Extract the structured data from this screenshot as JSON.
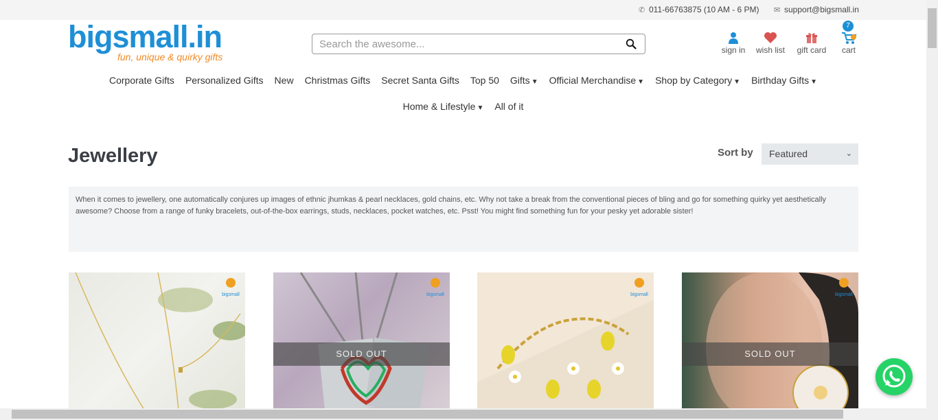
{
  "topbar": {
    "phone": "011-66763875 (10 AM - 6 PM)",
    "email": "support@bigsmall.in"
  },
  "logo": {
    "brand": "bigsmall.in",
    "tagline": "fun, unique & quirky gifts"
  },
  "search": {
    "placeholder": "Search the awesome..."
  },
  "account": {
    "signin": "sign in",
    "wishlist": "wish list",
    "giftcard": "gift card",
    "cart": "cart",
    "cart_count": "7"
  },
  "nav": {
    "row1": [
      "Corporate Gifts",
      "Personalized Gifts",
      "New",
      "Christmas Gifts",
      "Secret Santa Gifts",
      "Top 50",
      "Gifts",
      "Official Merchandise",
      "Shop by Category",
      "Birthday Gifts"
    ],
    "row2": [
      "Home & Lifestyle",
      "All of it"
    ]
  },
  "page": {
    "title": "Jewellery",
    "sort_label": "Sort by",
    "sort_value": "Featured"
  },
  "description": "When it comes to jewellery, one automatically conjures up images of ethnic jhumkas & pearl necklaces, gold chains, etc. Why not take a break from the conventional pieces of bling and go for something quirky yet aesthetically awesome? Choose from a range of funky bracelets, out-of-the-box earrings, studs, necklaces, pocket watches, etc. Psst! You might find something fun for your pesky yet adorable sister!",
  "products": [
    {
      "sold_out": ""
    },
    {
      "sold_out": "SOLD OUT"
    },
    {
      "sold_out": ""
    },
    {
      "sold_out": "SOLD OUT"
    }
  ],
  "colors": {
    "brand_blue": "#1e8fd6",
    "brand_orange": "#f08a24",
    "whatsapp": "#25d366",
    "wish_red": "#d9534f"
  }
}
